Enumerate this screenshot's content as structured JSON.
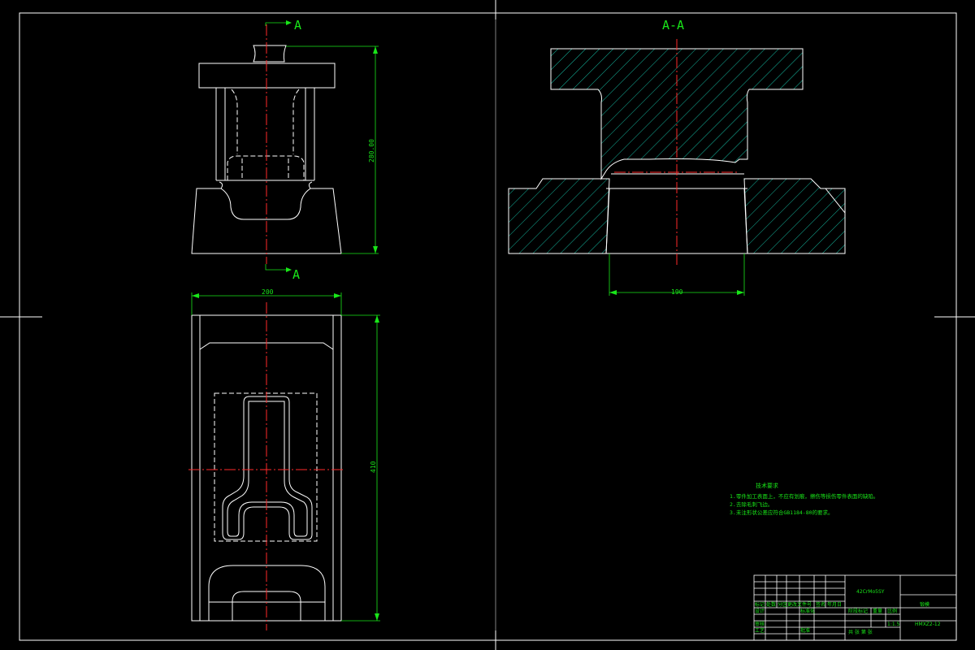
{
  "section_labels": {
    "top_marker": "A",
    "bottom_marker": "A",
    "section_title": "A-A"
  },
  "dimensions": {
    "height_front": "280.00",
    "width_plan": "200",
    "length_plan": "410",
    "bore_section": "190"
  },
  "notes": {
    "heading": "技术要求",
    "items": [
      "1.零件加工表面上，不应有划痕，擦伤等损伤零件表面的缺陷。",
      "2.去除毛刺飞边。",
      "3.未注形状公差应符合GB1184-80的要求。"
    ]
  },
  "title_block": {
    "material": "42CrMo5SY",
    "part_name": "锻模",
    "drawing_number": "HMXZ2-12",
    "scale": "1:1.5",
    "row_labels": [
      "标记",
      "处数",
      "分区",
      "更改文件号",
      "签名",
      "年月日"
    ],
    "design_label": "设计",
    "standardize_label": "标准化",
    "review_label": "审核",
    "process_label": "工艺",
    "approve_label": "批准",
    "stage_label": "阶段标记",
    "weight_label": "重量",
    "scale_label": "比例",
    "sheet_label": "共 张 第 张"
  },
  "colors": {
    "background": "#000000",
    "outline": "#ffffff",
    "centerline": "#ff2a2a",
    "dimension": "#19e619",
    "hatch": "#19e6c8"
  }
}
